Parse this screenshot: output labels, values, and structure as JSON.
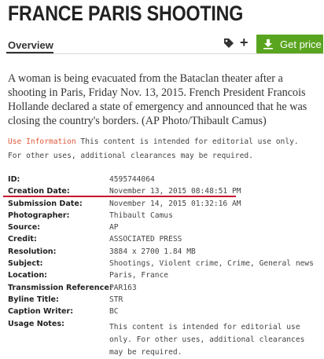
{
  "title": "FRANCE PARIS SHOOTING",
  "tabs": {
    "overview": "Overview"
  },
  "actions": {
    "get_price": "Get price",
    "plus": "+"
  },
  "caption": "A woman is being evacuated from the Bataclan theater after a shooting in Paris, Friday Nov. 13, 2015. French President Francois Hollande declared a state of emergency and announced that he was closing the country's borders. (AP Photo/Thibault Camus)",
  "usage": {
    "link": "Use Information",
    "text": " This content is intended for editorial use only. For other uses, additional clearances may be required."
  },
  "details": [
    {
      "label": "ID:",
      "value": "4595744064"
    },
    {
      "label": "Creation Date:",
      "value": "November 13, 2015 08:48:51 PM"
    },
    {
      "label": "Submission Date:",
      "value": "November 14, 2015 01:32:16 AM"
    },
    {
      "label": "Photographer:",
      "value": "Thibault Camus"
    },
    {
      "label": "Source:",
      "value": "AP"
    },
    {
      "label": "Credit:",
      "value": "ASSOCIATED PRESS"
    },
    {
      "label": "Resolution:",
      "value": "3884 x 2700 1.84 MB"
    },
    {
      "label": "Subject:",
      "value": "Shootings, Violent crime, Crime, General news"
    },
    {
      "label": "Location:",
      "value": "Paris, France"
    },
    {
      "label": "Transmission Reference:",
      "value": "PAR163"
    },
    {
      "label": "Byline Title:",
      "value": "STR"
    },
    {
      "label": "Caption Writer:",
      "value": "BC"
    },
    {
      "label": "Usage Notes:",
      "value": ""
    }
  ],
  "usage_notes": "This content is intended for editorial use only. For other uses, additional clearances may be required.",
  "colors": {
    "accent_green": "#5aa520",
    "link_red": "#e05a3a",
    "underline_red": "#c8102e"
  },
  "icons": [
    "tag-icon",
    "plus-icon",
    "download-icon"
  ]
}
